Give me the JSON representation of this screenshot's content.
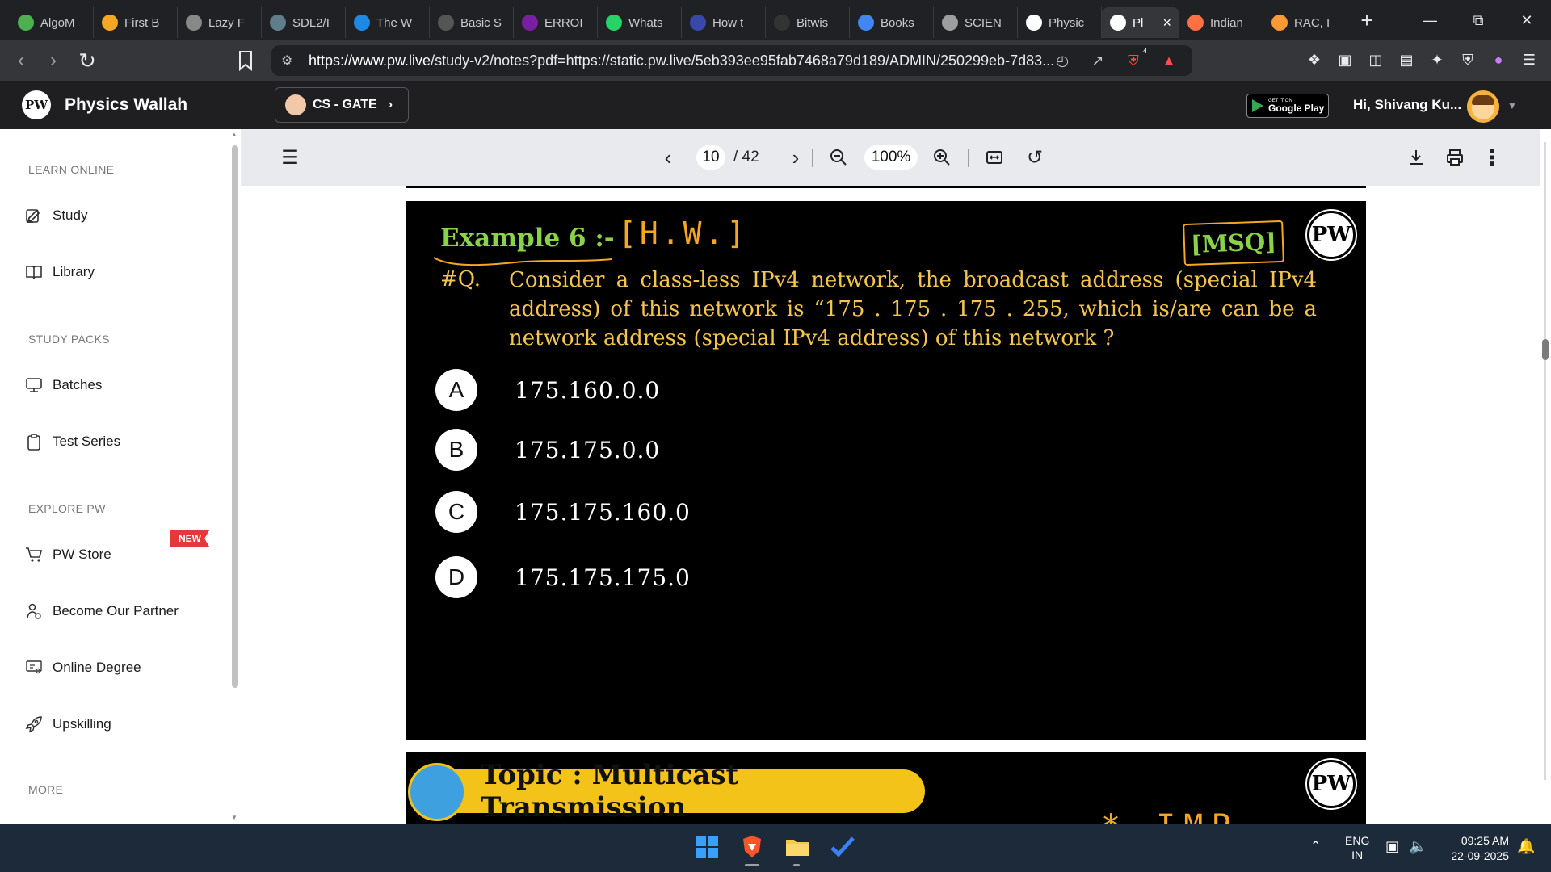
{
  "browser": {
    "tabs": [
      {
        "label": "AlgoM",
        "icon_color": "#4caf50"
      },
      {
        "label": "First B",
        "icon_color": "#f5a623"
      },
      {
        "label": "Lazy F",
        "icon_color": "#888888"
      },
      {
        "label": "SDL2/I",
        "icon_color": "#607d8b"
      },
      {
        "label": "The W",
        "icon_color": "#1e88e5"
      },
      {
        "label": "Basic S",
        "icon_color": "#555555"
      },
      {
        "label": "ERROI",
        "icon_color": "#7b1fa2"
      },
      {
        "label": "Whats",
        "icon_color": "#25d366"
      },
      {
        "label": "How t",
        "icon_color": "#3949ab"
      },
      {
        "label": "Bitwis",
        "icon_color": "#333333"
      },
      {
        "label": "Books",
        "icon_color": "#4285f4"
      },
      {
        "label": "SCIEN",
        "icon_color": "#9e9e9e"
      },
      {
        "label": "Physic",
        "icon_color": "#ffffff"
      },
      {
        "label": "Pl",
        "icon_color": "#ffffff",
        "active": true
      },
      {
        "label": "Indian",
        "icon_color": "#ff7043"
      },
      {
        "label": "RAC, I",
        "icon_color": "#ff9933"
      }
    ],
    "url_host": "https://www.pw.live",
    "url_rest": "/study-v2/notes?pdf=https://static.pw.live/5eb393ee95fab7468a79d189/ADMIN/250299eb-7d83...",
    "shield_count": "4"
  },
  "site": {
    "brand": "Physics Wallah",
    "logo_text": "PW",
    "batch": "CS - GATE",
    "gplay_small": "GET IT ON",
    "gplay_big": "Google Play",
    "greeting": "Hi, Shivang Ku..."
  },
  "sidebar": {
    "sections": [
      {
        "title": "LEARN ONLINE",
        "items": [
          "Study",
          "Library"
        ]
      },
      {
        "title": "STUDY PACKS",
        "items": [
          "Batches",
          "Test Series"
        ]
      },
      {
        "title": "EXPLORE PW",
        "items": [
          "PW Store",
          "Become Our Partner",
          "Online Degree",
          "Upskilling"
        ]
      },
      {
        "title": "MORE",
        "items": []
      }
    ],
    "new_badge": "NEW"
  },
  "pdf": {
    "page_current": "10",
    "page_total": "/ 42",
    "zoom": "100%"
  },
  "slide": {
    "example_title": "Example 6 :-",
    "hw_note": "[H.W.]",
    "msq_tag": "[MSQ]",
    "logo_text": "PW",
    "q_label": "#Q.",
    "question": "Consider a class-less IPv4 network, the broadcast address (special IPv4 address) of this network is “175 . 175 . 175 . 255, which is/are can be a network address (special IPv4 address) of this network ?",
    "options": [
      {
        "letter": "A",
        "value": "175.160.0.0"
      },
      {
        "letter": "B",
        "value": "175.175.0.0"
      },
      {
        "letter": "C",
        "value": "175.175.160.0"
      },
      {
        "letter": "D",
        "value": "175.175.175.0"
      }
    ]
  },
  "slide2": {
    "topic": "Topic : Multicast Transmission",
    "imp_note": "* IMP",
    "logo_text": "PW"
  },
  "taskbar": {
    "lang_1": "ENG",
    "lang_2": "IN",
    "time": "09:25 AM",
    "date": "22-09-2025"
  }
}
